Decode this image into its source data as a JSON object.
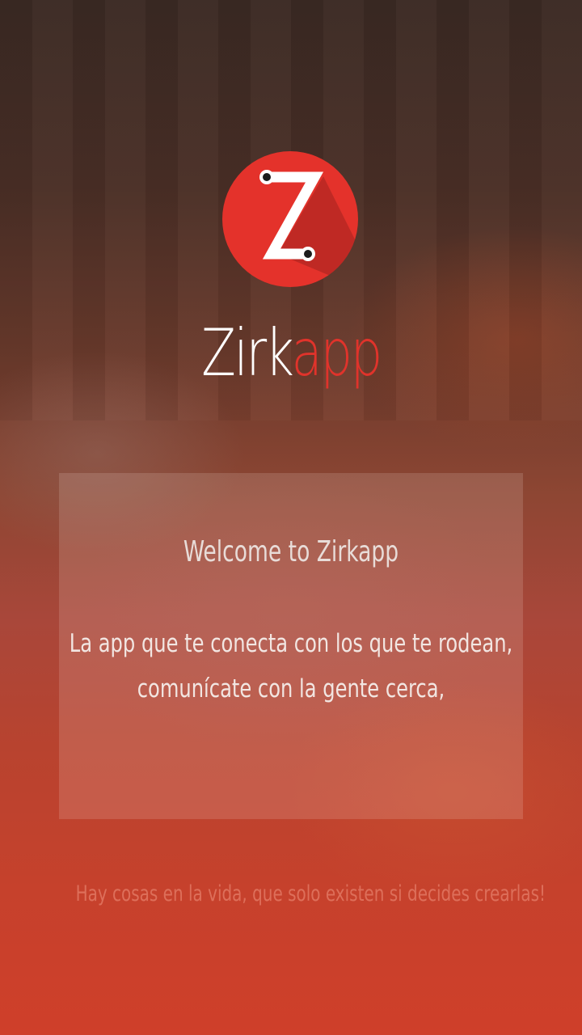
{
  "app": {
    "logo_icon": "zirkapp-logo-icon",
    "brand_primary": "Zirk",
    "brand_secondary": "app",
    "colors": {
      "accent": "#e0332b",
      "logo_circle": "#e4322b",
      "logo_letter": "#ffffff"
    }
  },
  "welcome": {
    "title": "Welcome to Zirkapp",
    "line1": "La app que te conecta con los que te rodean,",
    "line2": "comunícate con la gente cerca,"
  },
  "footer": {
    "tagline": "Hay cosas en la vida, que solo existen si decides crearlas!"
  }
}
